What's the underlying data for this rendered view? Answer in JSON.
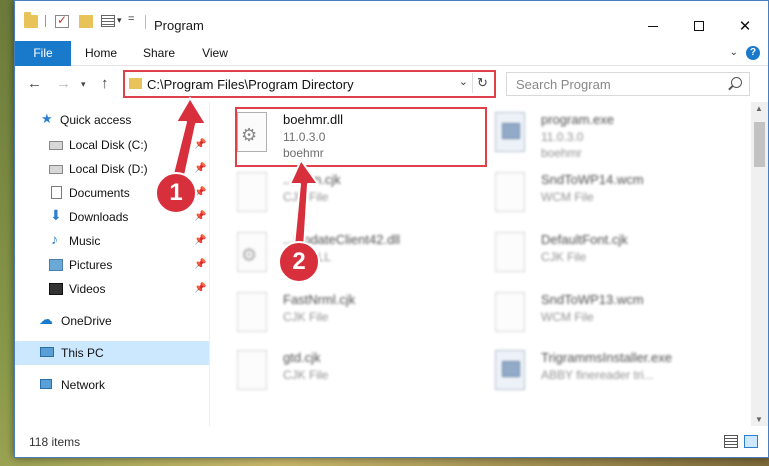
{
  "window": {
    "title": "Program",
    "min_glyph": "—",
    "max_glyph": "☐",
    "close_glyph": "✕"
  },
  "ribbon": {
    "tabs": [
      "File",
      "Home",
      "Share",
      "View"
    ],
    "help": "?"
  },
  "nav": {
    "back": "←",
    "forward": "→",
    "up": "↑",
    "address": "C:\\Program Files\\Program Directory",
    "search_placeholder": "Search Program"
  },
  "sidebar": {
    "items": [
      {
        "label": "Quick access",
        "icon": "star-icon",
        "pinned": false
      },
      {
        "label": "Local Disk (C:)",
        "icon": "drive-icon",
        "pinned": true
      },
      {
        "label": "Local Disk (D:)",
        "icon": "drive-icon",
        "pinned": true
      },
      {
        "label": "Documents",
        "icon": "documents-icon",
        "pinned": true
      },
      {
        "label": "Downloads",
        "icon": "download-icon",
        "pinned": true
      },
      {
        "label": "Music",
        "icon": "music-icon",
        "pinned": true
      },
      {
        "label": "Pictures",
        "icon": "pictures-icon",
        "pinned": true
      },
      {
        "label": "Videos",
        "icon": "videos-icon",
        "pinned": true
      },
      {
        "label": "OneDrive",
        "icon": "cloud-icon",
        "pinned": false
      },
      {
        "label": "This PC",
        "icon": "computer-icon",
        "pinned": false,
        "selected": true
      },
      {
        "label": "Network",
        "icon": "network-icon",
        "pinned": false
      }
    ]
  },
  "files": [
    {
      "name": "boehmr.dll",
      "line2": "11.0.3.0",
      "line3": "boehmr",
      "icon": "dll-gear-icon",
      "highlighted": true
    },
    {
      "name": "program.exe",
      "line2": "11.0.3.0",
      "line3": "boehmr",
      "icon": "exe-icon"
    },
    {
      "name": "...Korn.cjk",
      "line2": "CJK File",
      "line3": "",
      "icon": "blank-file-icon"
    },
    {
      "name": "SndToWP14.wcm",
      "line2": "WCM File",
      "line3": "",
      "icon": "blank-file-icon"
    },
    {
      "name": "...UpdateClient42.dll",
      "line2": "...ce DLL",
      "line3": "",
      "icon": "dll-gear-icon"
    },
    {
      "name": "DefaultFont.cjk",
      "line2": "CJK File",
      "line3": "",
      "icon": "blank-file-icon"
    },
    {
      "name": "FastNrml.cjk",
      "line2": "CJK File",
      "line3": "",
      "icon": "blank-file-icon"
    },
    {
      "name": "SndToWP13.wcm",
      "line2": "WCM File",
      "line3": "",
      "icon": "blank-file-icon"
    },
    {
      "name": "gtd.cjk",
      "line2": "CJK File",
      "line3": "",
      "icon": "blank-file-icon"
    },
    {
      "name": "TrigrammsInstaller.exe",
      "line2": "ABBY finereader tri...",
      "line3": "",
      "icon": "exe-icon"
    }
  ],
  "status": {
    "item_count": "118 items"
  },
  "annotations": {
    "step1": "1",
    "step2": "2",
    "color": "#d7303c"
  }
}
